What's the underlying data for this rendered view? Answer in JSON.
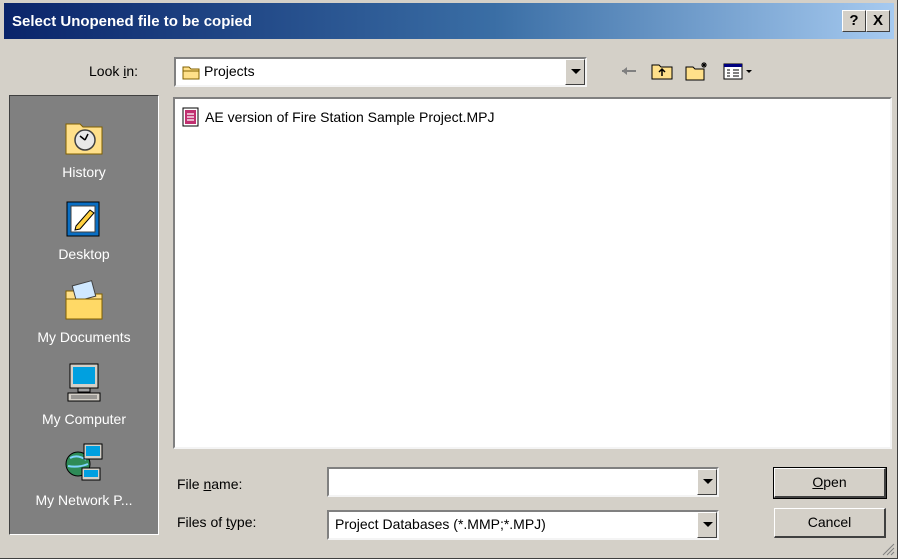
{
  "window": {
    "title": "Select Unopened file to be copied",
    "help_button": "?",
    "close_button": "X"
  },
  "look_in": {
    "label_pre": "Look ",
    "label_key": "i",
    "label_post": "n:",
    "value": "Projects"
  },
  "places": [
    {
      "label": "History",
      "icon": "history-icon"
    },
    {
      "label": "Desktop",
      "icon": "desktop-icon"
    },
    {
      "label": "My Documents",
      "icon": "my-documents-icon"
    },
    {
      "label": "My Computer",
      "icon": "my-computer-icon"
    },
    {
      "label": "My Network P...",
      "icon": "network-places-icon"
    }
  ],
  "files": [
    {
      "name": "AE version of Fire Station Sample Project.MPJ",
      "icon": "project-file-icon"
    }
  ],
  "file_name": {
    "label_pre": "File ",
    "label_key": "n",
    "label_post": "ame:",
    "value": ""
  },
  "file_type": {
    "label_pre": "Files of ",
    "label_key": "t",
    "label_post": "ype:",
    "value": "Project Databases (*.MMP;*.MPJ)"
  },
  "buttons": {
    "open_key": "O",
    "open_rest": "pen",
    "cancel": "Cancel"
  },
  "colors": {
    "title_bar_start": "#0a246a",
    "title_bar_end": "#a6caf0",
    "dialog_bg": "#d4d0c8",
    "places_bg": "#808080"
  }
}
